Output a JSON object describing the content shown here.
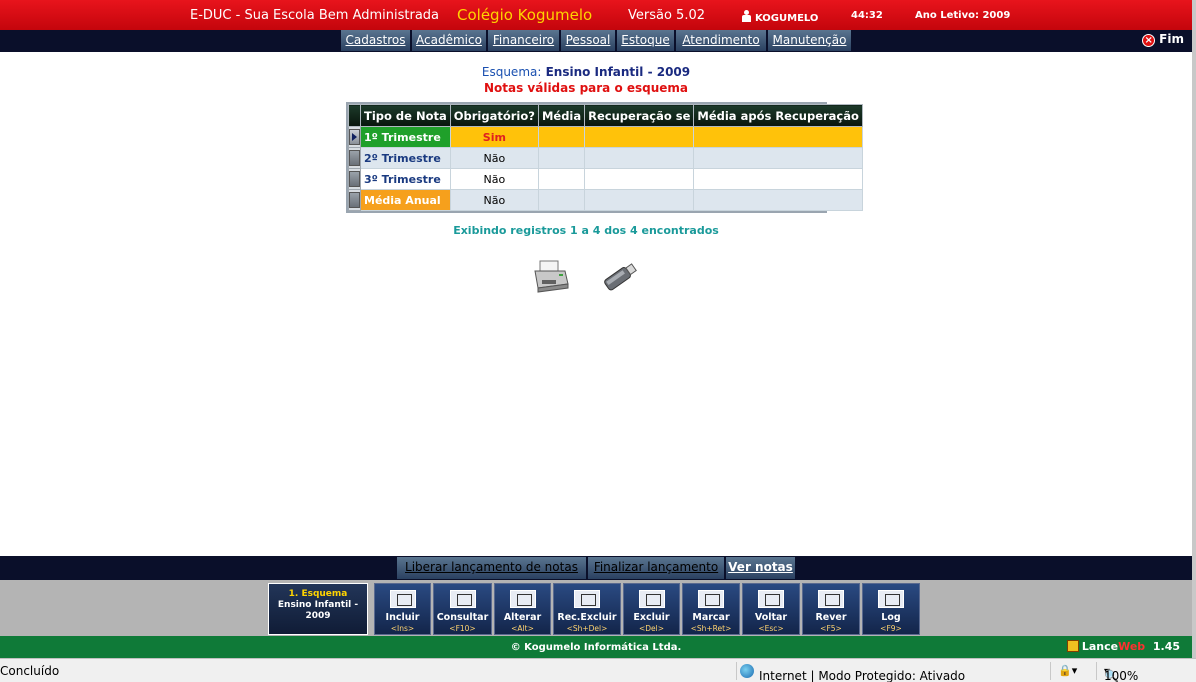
{
  "header": {
    "app_title": "E-DUC - Sua Escola Bem Administrada",
    "school": "Colégio Kogumelo",
    "version": "Versão 5.02",
    "user": "KOGUMELO",
    "timer": "44:32",
    "school_year": "Ano Letivo: 2009"
  },
  "menu": {
    "items": [
      "Cadastros",
      "Acadêmico",
      "Financeiro",
      "Pessoal",
      "Estoque",
      "Atendimento",
      "Manutenção"
    ],
    "exit_label": "Fim"
  },
  "content": {
    "scheme_label": "Esquema:",
    "scheme_value": "Ensino Infantil - 2009",
    "subtitle": "Notas válidas para o esquema",
    "columns": [
      "Tipo de Nota",
      "Obrigatório?",
      "Média",
      "Recuperação se",
      "Média após Recuperação"
    ],
    "rows": [
      {
        "tipo": "1º Trimestre",
        "obrigatorio": "Sim",
        "media": "",
        "recuperacao": "",
        "media_apos": ""
      },
      {
        "tipo": "2º Trimestre",
        "obrigatorio": "Não",
        "media": "",
        "recuperacao": "",
        "media_apos": ""
      },
      {
        "tipo": "3º Trimestre",
        "obrigatorio": "Não",
        "media": "",
        "recuperacao": "",
        "media_apos": ""
      },
      {
        "tipo": "Média Anual",
        "obrigatorio": "Não",
        "media": "",
        "recuperacao": "",
        "media_apos": ""
      }
    ],
    "records_text": "Exibindo registros 1 a 4 dos 4 encontrados",
    "print_icon": "printer-icon",
    "export_icon": "usb-drive-icon"
  },
  "actions": {
    "release_label": "Liberar lançamento de notas",
    "finalize_label": "Finalizar lançamento",
    "view_label": "Ver notas"
  },
  "context": {
    "line1": "1. Esquema",
    "line2": "Ensino Infantil -",
    "line3": "2009"
  },
  "toolbar": [
    {
      "label": "Incluir",
      "key": "<Ins>"
    },
    {
      "label": "Consultar",
      "key": "<F10>"
    },
    {
      "label": "Alterar",
      "key": "<Alt>"
    },
    {
      "label": "Rec.Excluir",
      "key": "<Sh+Del>"
    },
    {
      "label": "Excluir",
      "key": "<Del>"
    },
    {
      "label": "Marcar",
      "key": "<Sh+Ret>"
    },
    {
      "label": "Voltar",
      "key": "<Esc>"
    },
    {
      "label": "Rever",
      "key": "<F5>"
    },
    {
      "label": "Log",
      "key": "<F9>"
    }
  ],
  "footer": {
    "copyright": "© Kogumelo Informática Ltda.",
    "brand_a": "Lance",
    "brand_b": "Web",
    "brand_version": "1.45"
  },
  "statusbar": {
    "status": "Concluído",
    "zone": "Internet | Modo Protegido: Ativado",
    "zoom": "100%"
  },
  "colors": {
    "top_bar": "#d50a12",
    "selected_row": "#ffc20a",
    "footer_green": "#0f7a38"
  }
}
